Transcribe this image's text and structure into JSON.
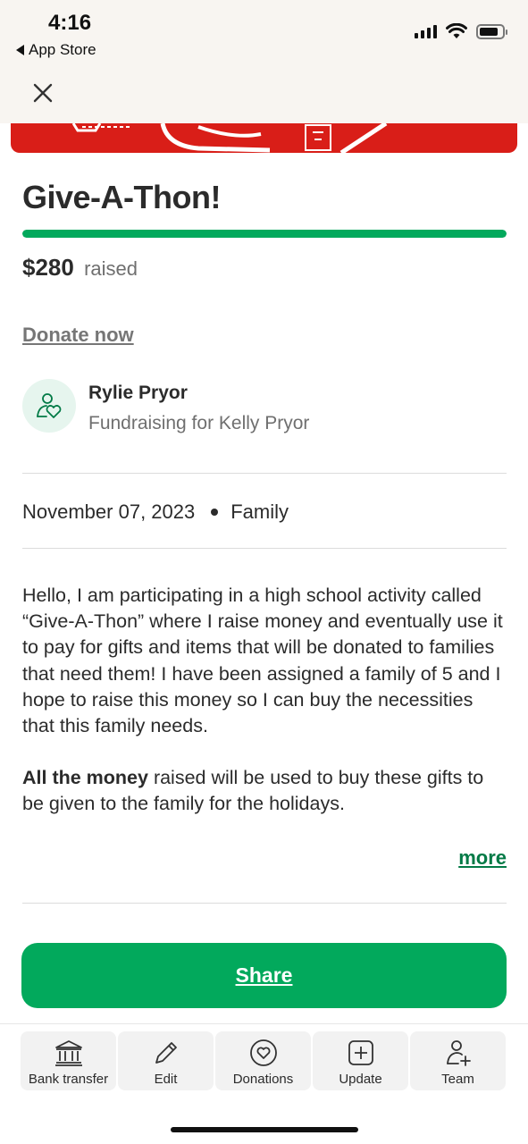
{
  "status_bar": {
    "time": "4:16",
    "back_label": "App Store"
  },
  "colors": {
    "accent": "#02a95c",
    "hero_red": "#d91e18",
    "link_green": "#027a46"
  },
  "campaign": {
    "title": "Give-A-Thon!",
    "progress_fraction": 1.0,
    "amount": "$280",
    "raised_label": "raised",
    "donate_label": "Donate now"
  },
  "organizer": {
    "name": "Rylie Pryor",
    "subtitle": "Fundraising for Kelly Pryor"
  },
  "meta": {
    "date": "November 07, 2023",
    "category": "Family"
  },
  "story": {
    "para1": "Hello, I am participating in a high school activity called “Give-A-Thon” where I raise money and eventually use it to pay for gifts and items that will be donated to families that need them! I have been assigned a family of 5 and I hope to raise this money so I can buy the necessities that this family needs.",
    "para2_bold": "All the money",
    "para2_rest": " raised will be used to buy these gifts to be given to the family for the holidays.",
    "more_label": "more"
  },
  "share_label": "Share",
  "bottom_tabs": [
    {
      "label": "Bank transfer",
      "icon": "bank-icon"
    },
    {
      "label": "Edit",
      "icon": "pencil-icon"
    },
    {
      "label": "Donations",
      "icon": "heart-icon"
    },
    {
      "label": "Update",
      "icon": "plus-square-icon"
    },
    {
      "label": "Team",
      "icon": "add-user-icon"
    }
  ]
}
